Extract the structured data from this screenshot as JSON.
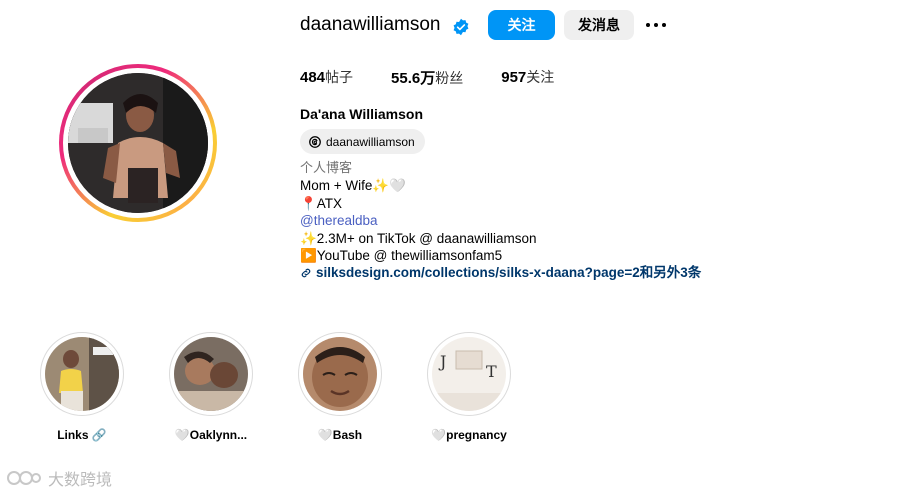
{
  "profile": {
    "username": "daanawilliamson",
    "verified": true,
    "follow_label": "关注",
    "message_label": "发消息",
    "full_name": "Da'ana Williamson",
    "threads_handle": "daanawilliamson"
  },
  "stats": {
    "posts_value": "484",
    "posts_label": "帖子",
    "followers_value": "55.6万",
    "followers_label": "粉丝",
    "following_value": "957",
    "following_label": "关注"
  },
  "bio": {
    "category": "个人博客",
    "line1": "Mom + Wife✨🤍",
    "line2": "📍ATX",
    "mention": "@therealdba",
    "line4": "✨2.3M+ on TikTok @ daanawilliamson",
    "line5": "▶️YouTube @ thewilliamsonfam5",
    "link": "silksdesign.com/collections/silks-x-daana?page=2和另外3条"
  },
  "highlights": [
    {
      "label": "Links 🔗"
    },
    {
      "label": "🤍Oaklynn..."
    },
    {
      "label": "🤍Bash"
    },
    {
      "label": "🤍pregnancy"
    }
  ],
  "watermark": {
    "text": "大数跨境"
  },
  "colors": {
    "accent": "#0095f6",
    "link": "#00376b",
    "mention": "#4a5fc1"
  }
}
